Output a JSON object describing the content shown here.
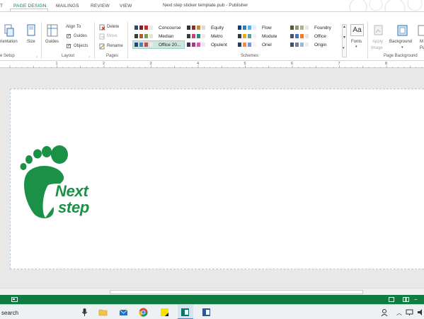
{
  "window": {
    "title": "Next step sticker template.pub - Publisher",
    "tabs": [
      {
        "label": "T"
      },
      {
        "label": "PAGE DESIGN"
      },
      {
        "label": "MAILINGS"
      },
      {
        "label": "REVIEW"
      },
      {
        "label": "VIEW"
      }
    ]
  },
  "ribbon": {
    "page_setup": {
      "orientation": "rientation",
      "size": "Size",
      "group": "e Setup"
    },
    "layout": {
      "guides": "Guides",
      "align_to": "Align To",
      "guides_cb": "Guides",
      "objects_cb": "Objects",
      "group": "Layout"
    },
    "pages": {
      "delete": "Delete",
      "move": "Move",
      "rename": "Rename",
      "group": "Pages"
    },
    "schemes": {
      "group": "Schemes",
      "items": [
        {
          "name": "Concourse",
          "colors": [
            "#2e4a62",
            "#8a1c1c",
            "#c72c2c",
            "#e9e9e9"
          ]
        },
        {
          "name": "Equity",
          "colors": [
            "#3a2f2a",
            "#8e2d2d",
            "#c08a3e",
            "#e6dac4"
          ]
        },
        {
          "name": "Flow",
          "colors": [
            "#123d6b",
            "#2a7fc4",
            "#56b4e9",
            "#dff1fb"
          ]
        },
        {
          "name": "Foundry",
          "colors": [
            "#4d5a3c",
            "#8a9a6a",
            "#a7b48a",
            "#e7ebdd"
          ]
        },
        {
          "name": "Median",
          "colors": [
            "#3f3a33",
            "#b75b2c",
            "#7a9b50",
            "#e8e2d2"
          ]
        },
        {
          "name": "Metro",
          "colors": [
            "#3b3b3b",
            "#d63a7d",
            "#2d8b82",
            "#f4e8ef"
          ]
        },
        {
          "name": "Module",
          "colors": [
            "#2f3a45",
            "#f2a900",
            "#5f9ea0",
            "#eef3f5"
          ]
        },
        {
          "name": "Office",
          "colors": [
            "#44546a",
            "#4472c4",
            "#ed7d31",
            "#e7e6e6"
          ]
        },
        {
          "name": "Office 20...",
          "colors": [
            "#1f497d",
            "#4f81bd",
            "#c0504d",
            "#eeece1"
          ]
        },
        {
          "name": "Opulent",
          "colors": [
            "#4b2a5e",
            "#a43b8e",
            "#d85ab3",
            "#f4e3f0"
          ]
        },
        {
          "name": "Oriel",
          "colors": [
            "#2b3a55",
            "#fe8637",
            "#7598d9",
            "#fff2e6"
          ]
        },
        {
          "name": "Origin",
          "colors": [
            "#3e5061",
            "#727ca3",
            "#9fb8cd",
            "#e8edf2"
          ]
        }
      ]
    },
    "fonts": {
      "label": "Fonts",
      "glyph": "Aa"
    },
    "background": {
      "apply": "Apply",
      "apply2": "Image",
      "background": "Background",
      "master": "M",
      "master2": "Pa",
      "group": "Page Background"
    }
  },
  "ruler": {
    "numbers": [
      "1",
      "2",
      "3",
      "4",
      "5",
      "6",
      "7",
      "8"
    ]
  },
  "document": {
    "logo_line1": "Next",
    "logo_line2": "step",
    "brand_color": "#1b9147"
  },
  "taskbar": {
    "search": "search",
    "accent": "#107c41"
  }
}
